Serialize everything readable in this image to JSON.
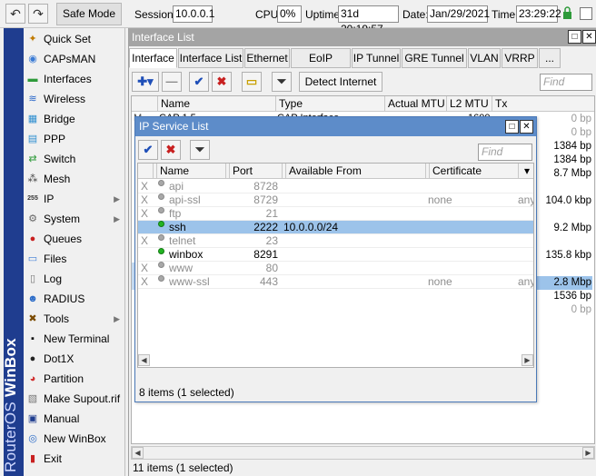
{
  "topbar": {
    "undo_icon": "undo-icon",
    "redo_icon": "redo-icon",
    "safe_mode": "Safe Mode",
    "session_label": "Session:",
    "session_value": "10.0.0.1",
    "cpu_label": "CPU:",
    "cpu_value": "0%",
    "uptime_label": "Uptime:",
    "uptime_value": "31d 20:19:57",
    "date_label": "Date:",
    "date_value": "Jan/29/2021",
    "time_label": "Time:",
    "time_value": "23:29:22"
  },
  "brand": {
    "prefix": "RouterOS ",
    "name": "WinBox"
  },
  "sidebar": {
    "items": [
      {
        "label": "Quick Set",
        "icon": "quickset-icon",
        "glyph": "✦",
        "color": "#c07a00",
        "submenu": false
      },
      {
        "label": "CAPsMAN",
        "icon": "capsman-icon",
        "glyph": "◉",
        "color": "#3a7bd5",
        "submenu": false
      },
      {
        "label": "Interfaces",
        "icon": "interfaces-icon",
        "glyph": "▬",
        "color": "#2e9a3a",
        "submenu": false
      },
      {
        "label": "Wireless",
        "icon": "wireless-icon",
        "glyph": "≋",
        "color": "#2866c9",
        "submenu": false
      },
      {
        "label": "Bridge",
        "icon": "bridge-icon",
        "glyph": "▦",
        "color": "#2f8fd0",
        "submenu": false
      },
      {
        "label": "PPP",
        "icon": "ppp-icon",
        "glyph": "▤",
        "color": "#2f8fd0",
        "submenu": false
      },
      {
        "label": "Switch",
        "icon": "switch-icon",
        "glyph": "⇄",
        "color": "#2e9a3a",
        "submenu": false
      },
      {
        "label": "Mesh",
        "icon": "mesh-icon",
        "glyph": "⁂",
        "color": "#444444",
        "submenu": false
      },
      {
        "label": "IP",
        "icon": "ip-icon",
        "glyph": "255",
        "color": "#333333",
        "submenu": true
      },
      {
        "label": "System",
        "icon": "system-icon",
        "glyph": "⚙",
        "color": "#666666",
        "submenu": true
      },
      {
        "label": "Queues",
        "icon": "queues-icon",
        "glyph": "●",
        "color": "#c82020",
        "submenu": false
      },
      {
        "label": "Files",
        "icon": "files-icon",
        "glyph": "▭",
        "color": "#3a7bd5",
        "submenu": false
      },
      {
        "label": "Log",
        "icon": "log-icon",
        "glyph": "▯",
        "color": "#777777",
        "submenu": false
      },
      {
        "label": "RADIUS",
        "icon": "radius-icon",
        "glyph": "☻",
        "color": "#2a6bc8",
        "submenu": false
      },
      {
        "label": "Tools",
        "icon": "tools-icon",
        "glyph": "✖",
        "color": "#7a4a00",
        "submenu": true
      },
      {
        "label": "New Terminal",
        "icon": "terminal-icon",
        "glyph": "▪",
        "color": "#111111",
        "submenu": false
      },
      {
        "label": "Dot1X",
        "icon": "dot1x-icon",
        "glyph": "●",
        "color": "#222222",
        "submenu": false
      },
      {
        "label": "Partition",
        "icon": "partition-icon",
        "glyph": "◕",
        "color": "#d03030",
        "submenu": false
      },
      {
        "label": "Make Supout.rif",
        "icon": "supout-icon",
        "glyph": "▧",
        "color": "#777777",
        "submenu": false
      },
      {
        "label": "Manual",
        "icon": "manual-icon",
        "glyph": "▣",
        "color": "#1f3d8f",
        "submenu": false
      },
      {
        "label": "New WinBox",
        "icon": "winbox-icon",
        "glyph": "◎",
        "color": "#2a6bc8",
        "submenu": false
      },
      {
        "label": "Exit",
        "icon": "exit-icon",
        "glyph": "▮",
        "color": "#c82020",
        "submenu": false
      }
    ]
  },
  "interface_window": {
    "title": "Interface List",
    "tabs": [
      "Interface",
      "Interface List",
      "Ethernet",
      "EoIP Tunnel",
      "IP Tunnel",
      "GRE Tunnel",
      "VLAN",
      "VRRP",
      "..."
    ],
    "detect_label": "Detect Internet",
    "find_placeholder": "Find",
    "columns": [
      "Name",
      "Type",
      "Actual MTU",
      "L2 MTU",
      "Tx"
    ],
    "tx_values": [
      "0 bp",
      "0 bp",
      "1384 bp",
      "1384 bp",
      "8.7 Mbp",
      "",
      "104.0 kbp",
      "",
      "9.2 Mbp",
      "",
      "135.8 kbp",
      "",
      "2.8 Mbp",
      "1536 bp",
      "0 bp"
    ],
    "partial_type": "CAP Interface",
    "partial_name": "CAP 1 5",
    "partial_l2": "1600",
    "status": "11 items (1 selected)"
  },
  "service_window": {
    "title": "IP Service List",
    "find_placeholder": "Find",
    "columns": [
      "Name",
      "Port",
      "Available From",
      "Certificate"
    ],
    "rows": [
      {
        "flag": "X",
        "name": "api",
        "port": "8728",
        "from": "",
        "cert": "",
        "extra": "",
        "enabled": false,
        "selected": false
      },
      {
        "flag": "X",
        "name": "api-ssl",
        "port": "8729",
        "from": "",
        "cert": "none",
        "extra": "any",
        "enabled": false,
        "selected": false
      },
      {
        "flag": "X",
        "name": "ftp",
        "port": "21",
        "from": "",
        "cert": "",
        "extra": "",
        "enabled": false,
        "selected": false
      },
      {
        "flag": "",
        "name": "ssh",
        "port": "2222",
        "from": "10.0.0.0/24",
        "cert": "",
        "extra": "",
        "enabled": true,
        "selected": true
      },
      {
        "flag": "X",
        "name": "telnet",
        "port": "23",
        "from": "",
        "cert": "",
        "extra": "",
        "enabled": false,
        "selected": false
      },
      {
        "flag": "",
        "name": "winbox",
        "port": "8291",
        "from": "",
        "cert": "",
        "extra": "",
        "enabled": true,
        "selected": false
      },
      {
        "flag": "X",
        "name": "www",
        "port": "80",
        "from": "",
        "cert": "",
        "extra": "",
        "enabled": false,
        "selected": false
      },
      {
        "flag": "X",
        "name": "www-ssl",
        "port": "443",
        "from": "",
        "cert": "none",
        "extra": "any",
        "enabled": false,
        "selected": false
      }
    ],
    "status": "8 items (1 selected)"
  }
}
